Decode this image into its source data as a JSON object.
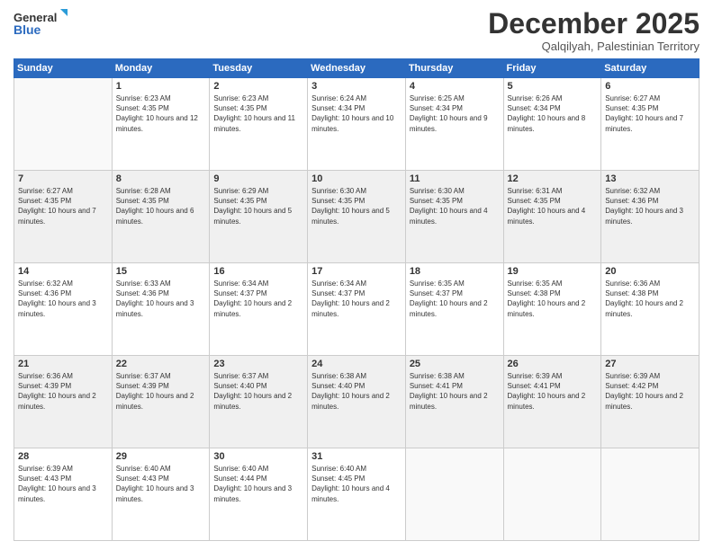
{
  "logo": {
    "line1": "General",
    "line2": "Blue"
  },
  "title": "December 2025",
  "subtitle": "Qalqilyah, Palestinian Territory",
  "weekdays": [
    "Sunday",
    "Monday",
    "Tuesday",
    "Wednesday",
    "Thursday",
    "Friday",
    "Saturday"
  ],
  "weeks": [
    [
      {
        "day": "",
        "sunrise": "",
        "sunset": "",
        "daylight": ""
      },
      {
        "day": "1",
        "sunrise": "Sunrise: 6:23 AM",
        "sunset": "Sunset: 4:35 PM",
        "daylight": "Daylight: 10 hours and 12 minutes."
      },
      {
        "day": "2",
        "sunrise": "Sunrise: 6:23 AM",
        "sunset": "Sunset: 4:35 PM",
        "daylight": "Daylight: 10 hours and 11 minutes."
      },
      {
        "day": "3",
        "sunrise": "Sunrise: 6:24 AM",
        "sunset": "Sunset: 4:34 PM",
        "daylight": "Daylight: 10 hours and 10 minutes."
      },
      {
        "day": "4",
        "sunrise": "Sunrise: 6:25 AM",
        "sunset": "Sunset: 4:34 PM",
        "daylight": "Daylight: 10 hours and 9 minutes."
      },
      {
        "day": "5",
        "sunrise": "Sunrise: 6:26 AM",
        "sunset": "Sunset: 4:34 PM",
        "daylight": "Daylight: 10 hours and 8 minutes."
      },
      {
        "day": "6",
        "sunrise": "Sunrise: 6:27 AM",
        "sunset": "Sunset: 4:35 PM",
        "daylight": "Daylight: 10 hours and 7 minutes."
      }
    ],
    [
      {
        "day": "7",
        "sunrise": "Sunrise: 6:27 AM",
        "sunset": "Sunset: 4:35 PM",
        "daylight": "Daylight: 10 hours and 7 minutes."
      },
      {
        "day": "8",
        "sunrise": "Sunrise: 6:28 AM",
        "sunset": "Sunset: 4:35 PM",
        "daylight": "Daylight: 10 hours and 6 minutes."
      },
      {
        "day": "9",
        "sunrise": "Sunrise: 6:29 AM",
        "sunset": "Sunset: 4:35 PM",
        "daylight": "Daylight: 10 hours and 5 minutes."
      },
      {
        "day": "10",
        "sunrise": "Sunrise: 6:30 AM",
        "sunset": "Sunset: 4:35 PM",
        "daylight": "Daylight: 10 hours and 5 minutes."
      },
      {
        "day": "11",
        "sunrise": "Sunrise: 6:30 AM",
        "sunset": "Sunset: 4:35 PM",
        "daylight": "Daylight: 10 hours and 4 minutes."
      },
      {
        "day": "12",
        "sunrise": "Sunrise: 6:31 AM",
        "sunset": "Sunset: 4:35 PM",
        "daylight": "Daylight: 10 hours and 4 minutes."
      },
      {
        "day": "13",
        "sunrise": "Sunrise: 6:32 AM",
        "sunset": "Sunset: 4:36 PM",
        "daylight": "Daylight: 10 hours and 3 minutes."
      }
    ],
    [
      {
        "day": "14",
        "sunrise": "Sunrise: 6:32 AM",
        "sunset": "Sunset: 4:36 PM",
        "daylight": "Daylight: 10 hours and 3 minutes."
      },
      {
        "day": "15",
        "sunrise": "Sunrise: 6:33 AM",
        "sunset": "Sunset: 4:36 PM",
        "daylight": "Daylight: 10 hours and 3 minutes."
      },
      {
        "day": "16",
        "sunrise": "Sunrise: 6:34 AM",
        "sunset": "Sunset: 4:37 PM",
        "daylight": "Daylight: 10 hours and 2 minutes."
      },
      {
        "day": "17",
        "sunrise": "Sunrise: 6:34 AM",
        "sunset": "Sunset: 4:37 PM",
        "daylight": "Daylight: 10 hours and 2 minutes."
      },
      {
        "day": "18",
        "sunrise": "Sunrise: 6:35 AM",
        "sunset": "Sunset: 4:37 PM",
        "daylight": "Daylight: 10 hours and 2 minutes."
      },
      {
        "day": "19",
        "sunrise": "Sunrise: 6:35 AM",
        "sunset": "Sunset: 4:38 PM",
        "daylight": "Daylight: 10 hours and 2 minutes."
      },
      {
        "day": "20",
        "sunrise": "Sunrise: 6:36 AM",
        "sunset": "Sunset: 4:38 PM",
        "daylight": "Daylight: 10 hours and 2 minutes."
      }
    ],
    [
      {
        "day": "21",
        "sunrise": "Sunrise: 6:36 AM",
        "sunset": "Sunset: 4:39 PM",
        "daylight": "Daylight: 10 hours and 2 minutes."
      },
      {
        "day": "22",
        "sunrise": "Sunrise: 6:37 AM",
        "sunset": "Sunset: 4:39 PM",
        "daylight": "Daylight: 10 hours and 2 minutes."
      },
      {
        "day": "23",
        "sunrise": "Sunrise: 6:37 AM",
        "sunset": "Sunset: 4:40 PM",
        "daylight": "Daylight: 10 hours and 2 minutes."
      },
      {
        "day": "24",
        "sunrise": "Sunrise: 6:38 AM",
        "sunset": "Sunset: 4:40 PM",
        "daylight": "Daylight: 10 hours and 2 minutes."
      },
      {
        "day": "25",
        "sunrise": "Sunrise: 6:38 AM",
        "sunset": "Sunset: 4:41 PM",
        "daylight": "Daylight: 10 hours and 2 minutes."
      },
      {
        "day": "26",
        "sunrise": "Sunrise: 6:39 AM",
        "sunset": "Sunset: 4:41 PM",
        "daylight": "Daylight: 10 hours and 2 minutes."
      },
      {
        "day": "27",
        "sunrise": "Sunrise: 6:39 AM",
        "sunset": "Sunset: 4:42 PM",
        "daylight": "Daylight: 10 hours and 2 minutes."
      }
    ],
    [
      {
        "day": "28",
        "sunrise": "Sunrise: 6:39 AM",
        "sunset": "Sunset: 4:43 PM",
        "daylight": "Daylight: 10 hours and 3 minutes."
      },
      {
        "day": "29",
        "sunrise": "Sunrise: 6:40 AM",
        "sunset": "Sunset: 4:43 PM",
        "daylight": "Daylight: 10 hours and 3 minutes."
      },
      {
        "day": "30",
        "sunrise": "Sunrise: 6:40 AM",
        "sunset": "Sunset: 4:44 PM",
        "daylight": "Daylight: 10 hours and 3 minutes."
      },
      {
        "day": "31",
        "sunrise": "Sunrise: 6:40 AM",
        "sunset": "Sunset: 4:45 PM",
        "daylight": "Daylight: 10 hours and 4 minutes."
      },
      {
        "day": "",
        "sunrise": "",
        "sunset": "",
        "daylight": ""
      },
      {
        "day": "",
        "sunrise": "",
        "sunset": "",
        "daylight": ""
      },
      {
        "day": "",
        "sunrise": "",
        "sunset": "",
        "daylight": ""
      }
    ]
  ]
}
